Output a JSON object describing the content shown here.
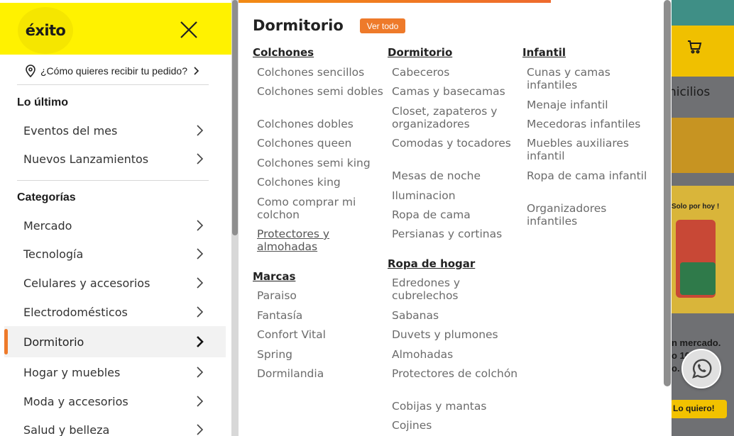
{
  "brand": {
    "logo_text": "éxito"
  },
  "delivery": {
    "label": "¿Cómo quieres recibir tu pedido?"
  },
  "sidebar": {
    "latest_title": "Lo último",
    "latest_items": [
      {
        "label": "Eventos del mes"
      },
      {
        "label": "Nuevos Lanzamientos"
      }
    ],
    "categories_title": "Categorías",
    "categories": [
      {
        "label": "Mercado"
      },
      {
        "label": "Tecnología"
      },
      {
        "label": "Celulares y accesorios"
      },
      {
        "label": "Electrodomésticos"
      },
      {
        "label": "Dormitorio"
      },
      {
        "label": "Hogar y muebles"
      },
      {
        "label": "Moda y accesorios"
      },
      {
        "label": "Salud y belleza"
      }
    ]
  },
  "mega": {
    "title": "Dormitorio",
    "ver_todo": "Ver todo",
    "columns": [
      {
        "heading": "Colchones",
        "links": [
          "Colchones sencillos",
          "Colchones semi dobles",
          "Colchones dobles",
          "Colchones queen",
          "Colchones semi king",
          "Colchones king",
          "Como comprar mi colchon",
          "Protectores y almohadas"
        ]
      },
      {
        "heading": "Marcas",
        "links": [
          "Paraiso",
          "Fantasía",
          "Confort Vital",
          "Spring",
          "Dormilandia"
        ]
      },
      {
        "heading": "Dormitorio",
        "links": [
          "Cabeceros",
          "Camas y basecamas",
          "Closet, zapateros y organizadores",
          "Comodas y tocadores",
          "Mesas de noche",
          "Iluminacion",
          "Ropa de cama",
          "Persianas y cortinas"
        ]
      },
      {
        "heading": "Ropa de hogar",
        "links": [
          "Edredones y cubrelechos",
          "Sabanas",
          "Duvets y plumones",
          "Almohadas",
          "Protectores de colchón",
          "Cobijas y mantas",
          "Cojines"
        ]
      },
      {
        "heading": "Infantil",
        "links": [
          "Cunas y camas infantiles",
          "Menaje infantil",
          "Mecedoras infantiles",
          "Muebles auxiliares infantil",
          "Ropa de cama infantil",
          "Organizadores infantiles"
        ]
      }
    ]
  },
  "background": {
    "domicilios_fragment": "nicilios",
    "promo_tag": "Solo por hoy !",
    "text_line1": "n mercado.",
    "text_line2": "o 10%",
    "text_line3": "o.",
    "cta": "Lo quiero!"
  },
  "colors": {
    "brand_yellow": "#fff200",
    "accent_orange": "#ee7a2a"
  }
}
